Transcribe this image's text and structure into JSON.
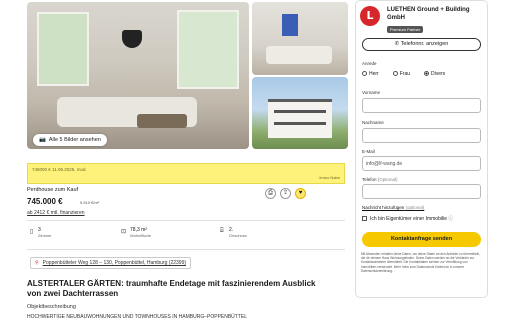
{
  "gallery": {
    "button_label": "Alle 5 Bilder ansehen"
  },
  "ad_banner": {
    "line1": "745000 € 11.06.2025, mod",
    "line2": "Immo Nabe"
  },
  "listing": {
    "type": "Penthouse zum Kauf",
    "price": "745.000 €",
    "price_per_sqm": "9.510 €/m²",
    "financing": "ab 2412 € mtl. finanzieren",
    "facts": [
      {
        "icon": "door-icon",
        "value": "3",
        "label": "Zimmer"
      },
      {
        "icon": "area-icon",
        "value": "78,3 m²",
        "label": "Wohnfläche"
      },
      {
        "icon": "stairs-icon",
        "value": "2.",
        "label": "Geschoss"
      }
    ],
    "address": "Poppenbütteler Weg 128 – 130, Poppenbüttel, Hamburg (22399)",
    "headline": "ALSTERTALER GÄRTEN: traumhafte Endetage mit faszinierendem Ausblick von zwei Dachterrassen",
    "description_label": "Objektbeschreibung",
    "description_text": "HOCHWERTIGE NEUBAUWOHNUNGEN UND TOWNHOUSES IN HAMBURG–POPPENBÜTTEL"
  },
  "contact": {
    "logo_letter": "L",
    "company": "LUETHEN Ground + Building GmbH",
    "badge": "Premium Partner",
    "phone_button": "Telefonnr. anzeigen",
    "salutation_label": "Anrede",
    "salutation_options": [
      "Herr",
      "Frau",
      "Divers"
    ],
    "salutation_selected": "Divers",
    "firstname_label": "Vorname",
    "lastname_label": "Nachname",
    "email_label": "E-Mail",
    "email_value": "info@lf-wang.de",
    "phone_label": "Telefon",
    "phone_optional": "(Optional)",
    "message_label": "Nachricht hinzufügen",
    "message_optional": "(optional)",
    "owner_checkbox": "Ich bin Eigentümer einer Immobilie",
    "submit": "Kontaktanfrage senden",
    "disclaimer": "Mit Absenden erhalten deine Daten, um deine Daten an den Anbieter zu übermitteln, die dir deinem Haus Wohnungsfinden. Deine Daten werden an die Verkäufer zur Kontaktaufnahme übermittelt. Die Kontaktdaten werden zur Vermittlung von Immobilien verwendet. Mehr Infos zum Datenschutz findest du in unserer Datenschutzerklärung."
  },
  "colors": {
    "accent_yellow": "#f6c800",
    "logo_red": "#d7262c",
    "banner_yellow": "#fff27a"
  }
}
